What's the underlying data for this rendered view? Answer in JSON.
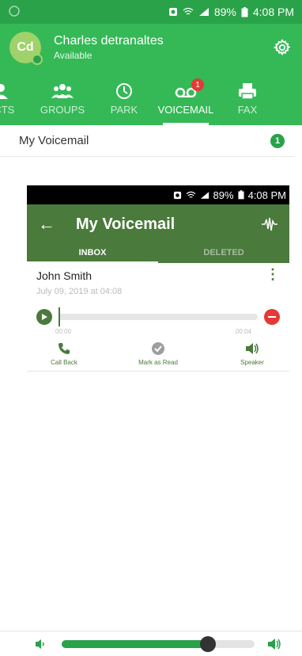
{
  "status_bar": {
    "battery": "89%",
    "time": "4:08 PM"
  },
  "user": {
    "initials": "Cd",
    "name": "Charles detranaltes",
    "status": "Available"
  },
  "tabs": [
    {
      "label": "ACTS",
      "icon": "contacts-icon"
    },
    {
      "label": "GROUPS",
      "icon": "groups-icon"
    },
    {
      "label": "PARK",
      "icon": "park-icon"
    },
    {
      "label": "VOICEMAIL",
      "icon": "voicemail-icon",
      "badge": "1",
      "active": true
    },
    {
      "label": "FAX",
      "icon": "fax-icon"
    }
  ],
  "voicemail_row": {
    "label": "My Voicemail",
    "count": "1"
  },
  "inner": {
    "status_bar": {
      "battery": "89%",
      "time": "4:08 PM"
    },
    "title": "My Voicemail",
    "tabs": [
      "INBOX",
      "DELETED"
    ],
    "message": {
      "caller": "John Smith",
      "date": "July 09, 2019 at 04:08",
      "time_start": "00:00",
      "time_end": "00:04",
      "progress": 0.0
    },
    "actions": [
      "Call Back",
      "Mark as Read",
      "Speaker"
    ]
  },
  "volume": {
    "level": 0.76
  },
  "colors": {
    "brand_green": "#34b956",
    "dark_green": "#4a7a3c",
    "delete_red": "#e53935"
  }
}
